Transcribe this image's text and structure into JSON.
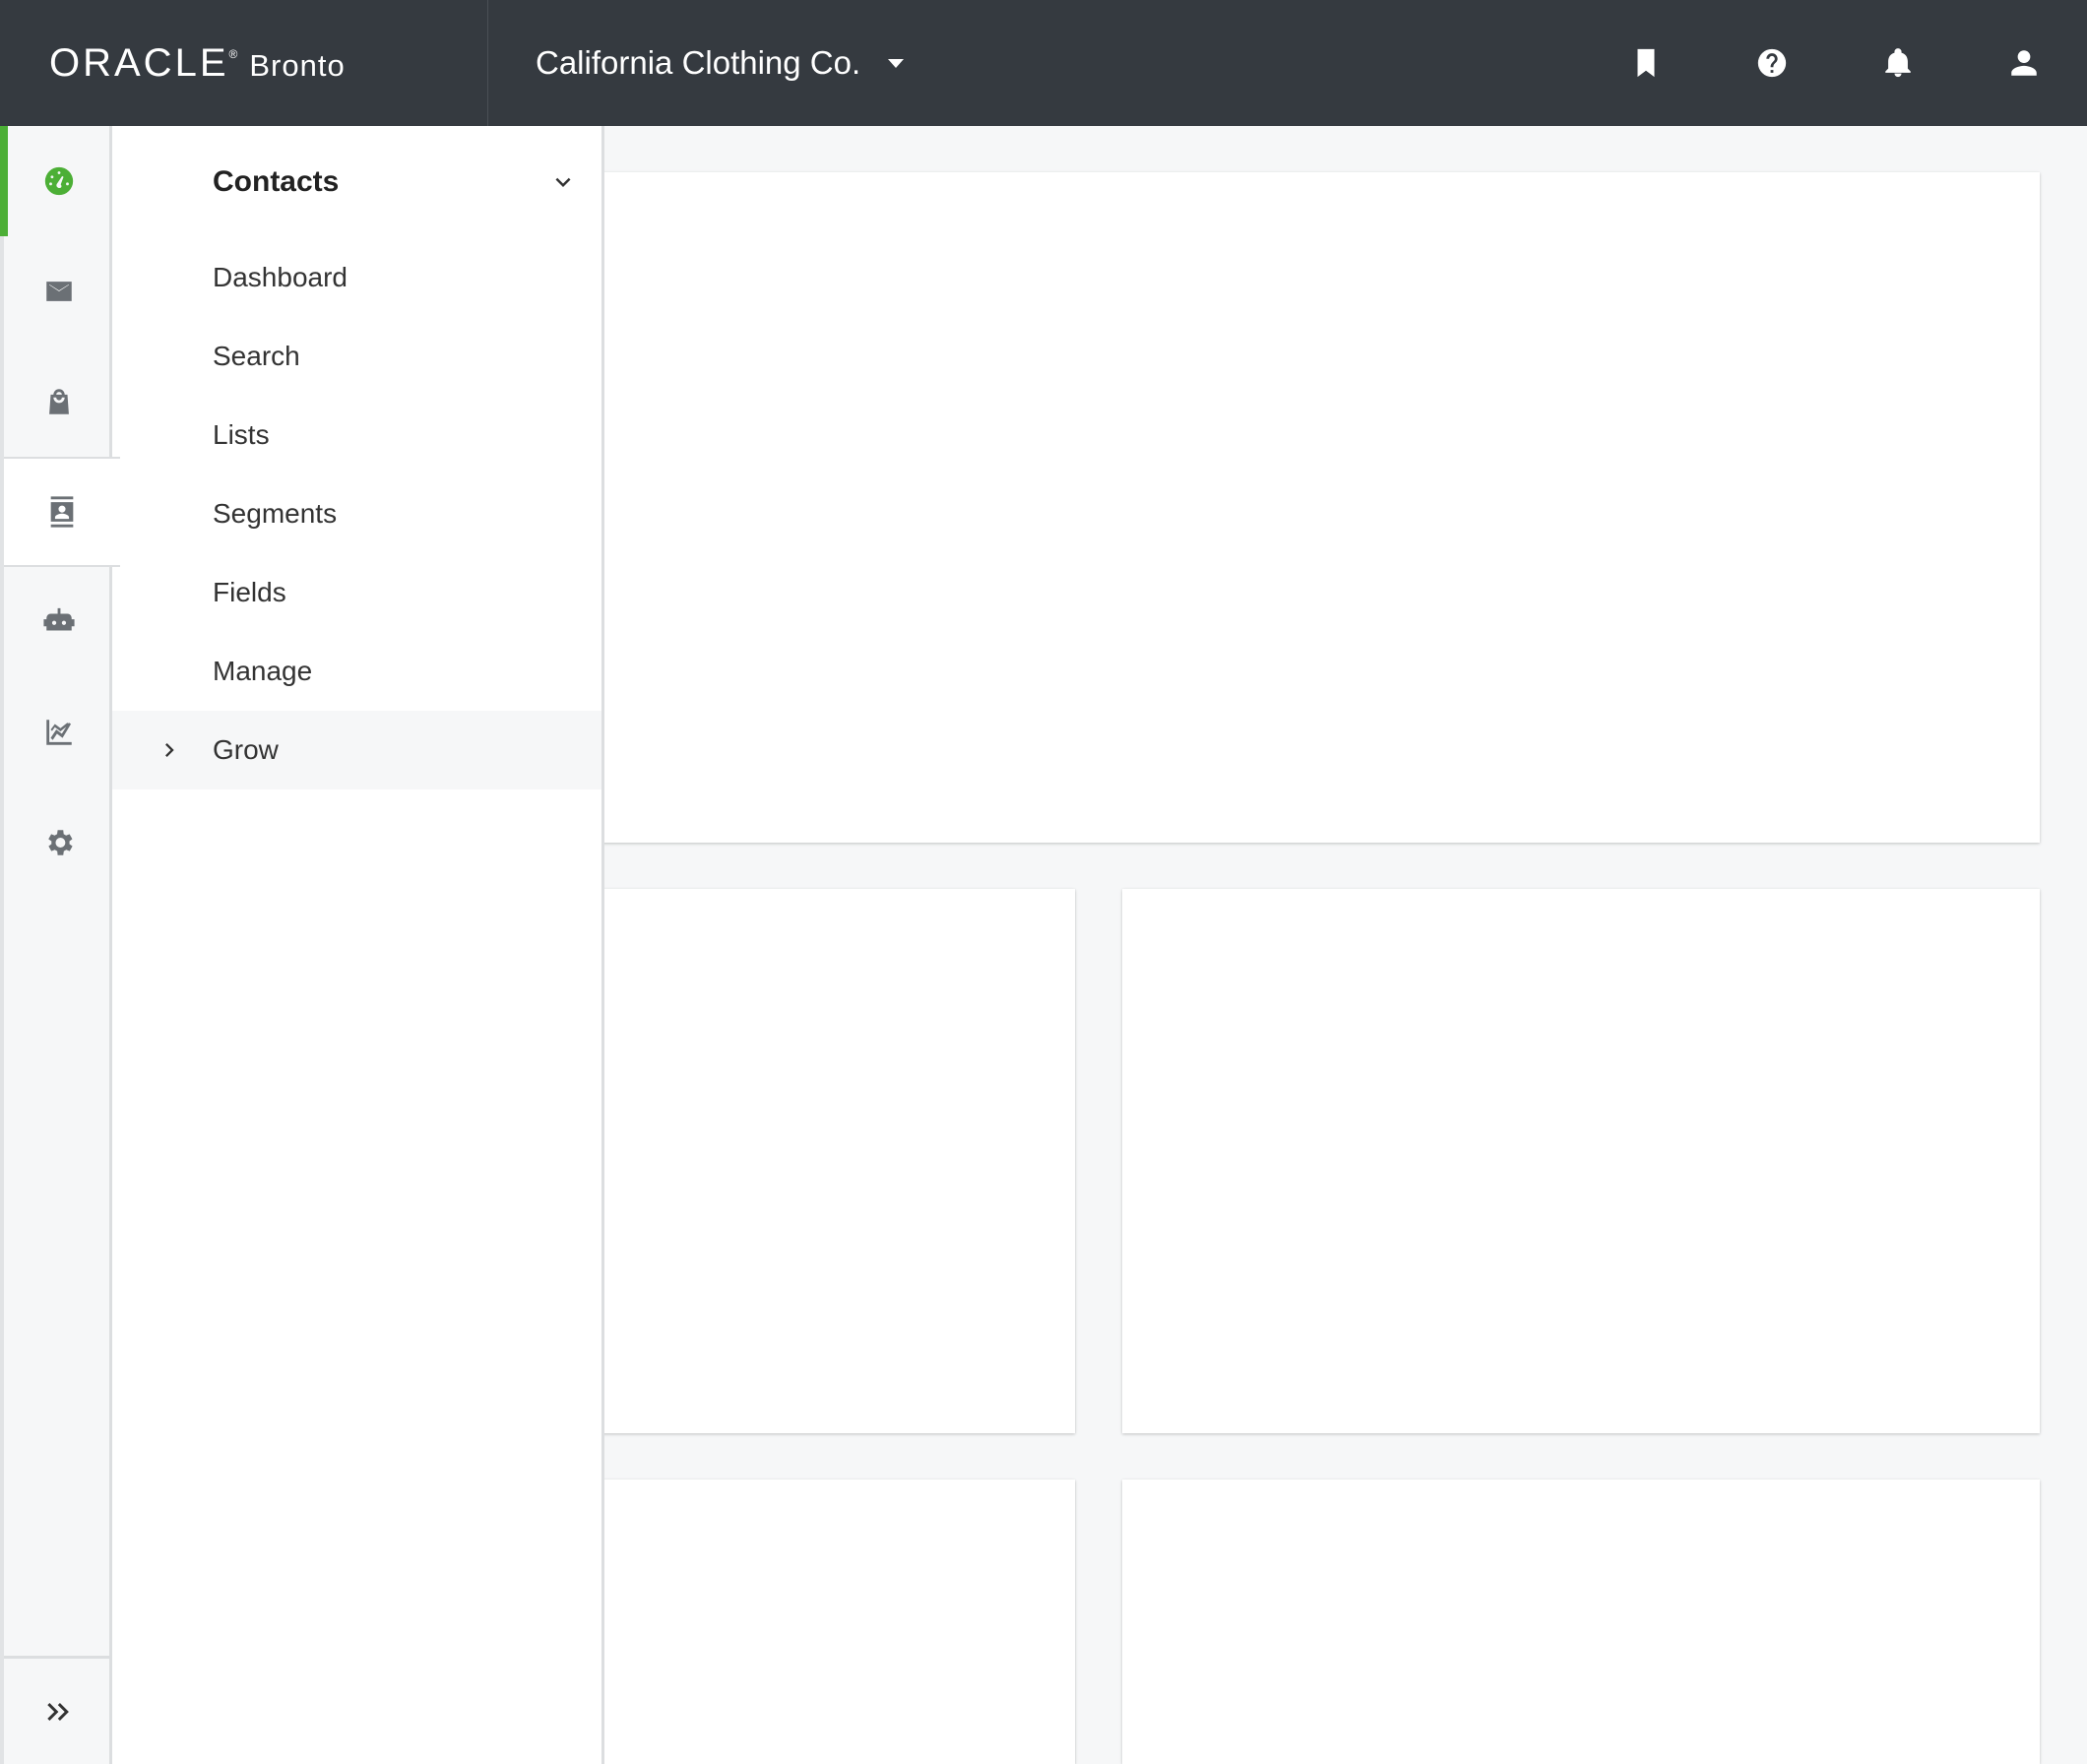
{
  "header": {
    "brand_oracle": "ORACLE",
    "brand_registered": "®",
    "brand_product": "Bronto",
    "account_name": "California Clothing Co.",
    "icons": [
      "bookmark-icon",
      "help-icon",
      "notifications-icon",
      "user-icon"
    ]
  },
  "rail": {
    "items": [
      {
        "name": "dashboard",
        "icon": "speedometer-icon",
        "active": true
      },
      {
        "name": "messages",
        "icon": "mail-icon"
      },
      {
        "name": "commerce",
        "icon": "shopping-bag-icon"
      },
      {
        "name": "contacts",
        "icon": "contact-card-icon",
        "selected": true
      },
      {
        "name": "automation",
        "icon": "robot-icon"
      },
      {
        "name": "reports",
        "icon": "chart-icon"
      },
      {
        "name": "settings",
        "icon": "gear-icon"
      }
    ],
    "expand_icon": "double-chevron-right-icon",
    "accent_color": "#4caf36"
  },
  "submenu": {
    "title": "Contacts",
    "items": [
      {
        "label": "Dashboard"
      },
      {
        "label": "Search"
      },
      {
        "label": "Lists"
      },
      {
        "label": "Segments"
      },
      {
        "label": "Fields"
      },
      {
        "label": "Manage"
      },
      {
        "label": "Grow",
        "has_children": true
      }
    ]
  },
  "colors": {
    "header_bg": "#353a40",
    "page_bg": "#f6f7f8",
    "accent": "#4caf36"
  }
}
